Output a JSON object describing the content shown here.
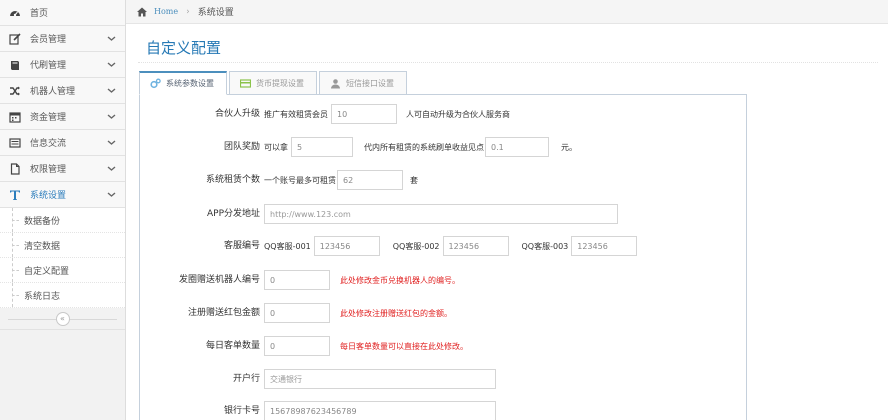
{
  "sidebar": {
    "items": [
      {
        "label": "首页",
        "icon": "dashboard-icon"
      },
      {
        "label": "会员管理",
        "icon": "edit-icon"
      },
      {
        "label": "代刷管理",
        "icon": "book-icon"
      },
      {
        "label": "机器人管理",
        "icon": "random-icon"
      },
      {
        "label": "资金管理",
        "icon": "calendar-icon"
      },
      {
        "label": "信息交流",
        "icon": "list-icon"
      },
      {
        "label": "权限管理",
        "icon": "file-icon"
      },
      {
        "label": "系统设置",
        "icon": "text-icon"
      }
    ],
    "sub_items": [
      "数据备份",
      "清空数据",
      "自定义配置",
      "系统日志"
    ],
    "collapse_glyph": "«"
  },
  "breadcrumb": {
    "home": "Home",
    "separator": "›",
    "current": "系统设置"
  },
  "page": {
    "title": "自定义配置"
  },
  "tabs": [
    {
      "label": "系统参数设置",
      "icon": "cogs-icon"
    },
    {
      "label": "货币提现设置",
      "icon": "credit-card-icon"
    },
    {
      "label": "短信接口设置",
      "icon": "user-icon"
    }
  ],
  "form": {
    "partner": {
      "label": "合伙人升级",
      "prefix": "推广有效租赁会员",
      "value": "10",
      "suffix": "人可自动升级为合伙人服务商"
    },
    "team": {
      "label": "团队奖励",
      "prefix": "可以拿",
      "value1": "5",
      "middle": "代内所有租赁的系统刷单收益见点",
      "value2": "0.1",
      "suffix": "元。"
    },
    "rent": {
      "label": "系统租赁个数",
      "prefix": "一个账号最多可租赁",
      "value": "62",
      "suffix": "套"
    },
    "app": {
      "label": "APP分发地址",
      "placeholder": "http://www.123.com"
    },
    "service": {
      "label": "客服编号",
      "entries": [
        {
          "name": "QQ客服-001",
          "value": "123456"
        },
        {
          "name": "QQ客服-002",
          "value": "123456"
        },
        {
          "name": "QQ客服-003",
          "value": "123456"
        }
      ]
    },
    "robot": {
      "label": "发圈赠送机器人编号",
      "value": "0",
      "hint": "此处修改金币兑换机器人的编号。"
    },
    "redpack": {
      "label": "注册赠送红包金额",
      "value": "0",
      "hint": "此处修改注册赠送红包的金额。"
    },
    "orders": {
      "label": "每日客单数量",
      "value": "0",
      "hint": "每日客单数量可以直接在此处修改。"
    },
    "bank": {
      "label": "开户行",
      "placeholder": "交通银行"
    },
    "card": {
      "label": "银行卡号",
      "value": "15678987623456789"
    }
  }
}
